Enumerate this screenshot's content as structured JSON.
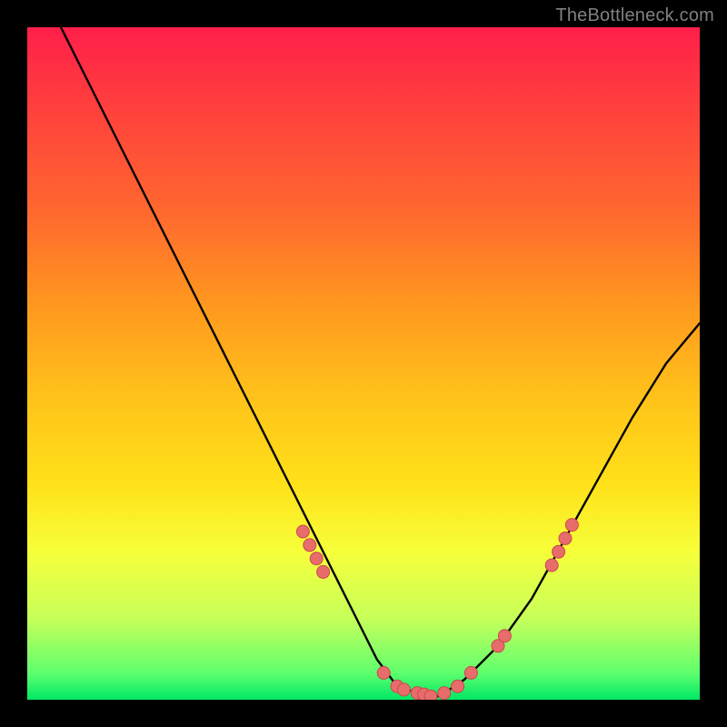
{
  "watermark": {
    "text": "TheBottleneck.com"
  },
  "colors": {
    "background": "#000000",
    "curve": "#000000",
    "dot_fill": "#e86c6c",
    "dot_stroke": "#c94a4a",
    "gradient_stops": [
      {
        "pos": 0.0,
        "hex": "#ff1f4a"
      },
      {
        "pos": 0.1,
        "hex": "#ff3a3f"
      },
      {
        "pos": 0.28,
        "hex": "#ff6a2e"
      },
      {
        "pos": 0.42,
        "hex": "#ff9a1e"
      },
      {
        "pos": 0.55,
        "hex": "#ffc21a"
      },
      {
        "pos": 0.68,
        "hex": "#ffe119"
      },
      {
        "pos": 0.78,
        "hex": "#f6ff3a"
      },
      {
        "pos": 0.88,
        "hex": "#c6ff5a"
      },
      {
        "pos": 0.96,
        "hex": "#5fff6e"
      },
      {
        "pos": 1.0,
        "hex": "#00e864"
      }
    ]
  },
  "chart_data": {
    "type": "line",
    "title": "",
    "xlabel": "",
    "ylabel": "",
    "xlim": [
      0,
      100
    ],
    "ylim": [
      0,
      100
    ],
    "series": [
      {
        "name": "bottleneck-curve",
        "x": [
          5,
          10,
          15,
          20,
          25,
          30,
          35,
          40,
          45,
          50,
          52,
          55,
          58,
          60,
          62,
          65,
          70,
          75,
          80,
          85,
          90,
          95,
          100
        ],
        "y": [
          100,
          90,
          80,
          70,
          60,
          50,
          40,
          30,
          20,
          10,
          6,
          2,
          1,
          0,
          1,
          3,
          8,
          15,
          24,
          33,
          42,
          50,
          56
        ]
      }
    ],
    "markers": {
      "name": "curve-dots",
      "points": [
        {
          "x": 41,
          "y": 25
        },
        {
          "x": 42,
          "y": 23
        },
        {
          "x": 43,
          "y": 21
        },
        {
          "x": 44,
          "y": 19
        },
        {
          "x": 53,
          "y": 4
        },
        {
          "x": 55,
          "y": 2
        },
        {
          "x": 56,
          "y": 1.5
        },
        {
          "x": 58,
          "y": 1
        },
        {
          "x": 59,
          "y": 0.8
        },
        {
          "x": 60,
          "y": 0.5
        },
        {
          "x": 62,
          "y": 1
        },
        {
          "x": 64,
          "y": 2
        },
        {
          "x": 66,
          "y": 4
        },
        {
          "x": 70,
          "y": 8
        },
        {
          "x": 71,
          "y": 9.5
        },
        {
          "x": 78,
          "y": 20
        },
        {
          "x": 79,
          "y": 22
        },
        {
          "x": 80,
          "y": 24
        },
        {
          "x": 81,
          "y": 26
        }
      ]
    }
  }
}
